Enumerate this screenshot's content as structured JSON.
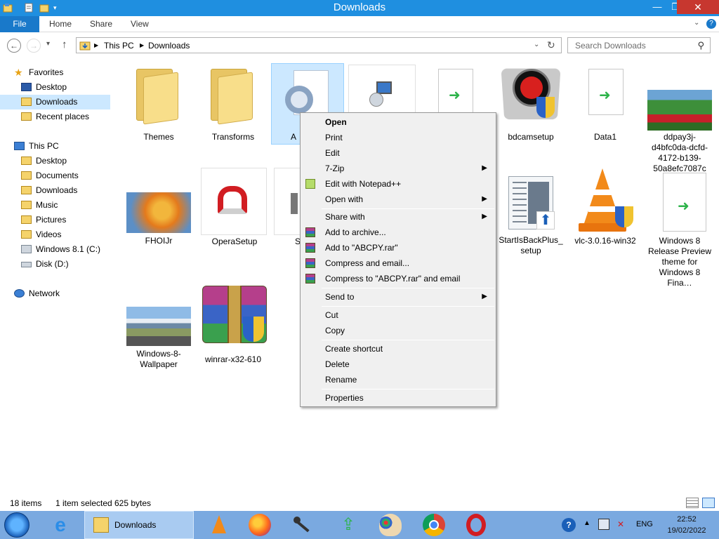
{
  "window": {
    "title": "Downloads",
    "controls": {
      "minimize": "—",
      "maximize": "❐",
      "close": "✕"
    }
  },
  "ribbon": {
    "file": "File",
    "tabs": [
      "Home",
      "Share",
      "View"
    ]
  },
  "nav": {
    "back": "←",
    "forward": "→",
    "recent": "▾",
    "up": "↑",
    "breadcrumb": [
      "This PC",
      "Downloads"
    ],
    "search_placeholder": "Search Downloads"
  },
  "sidebar": {
    "favorites": {
      "label": "Favorites",
      "items": [
        "Desktop",
        "Downloads",
        "Recent places"
      ]
    },
    "this_pc": {
      "label": "This PC",
      "items": [
        "Desktop",
        "Documents",
        "Downloads",
        "Music",
        "Pictures",
        "Videos",
        "Windows 8.1 (C:)",
        "Disk (D:)"
      ]
    },
    "network": {
      "label": "Network"
    }
  },
  "files": [
    {
      "name": "Themes",
      "icon": "folder-icon"
    },
    {
      "name": "Transforms",
      "icon": "folder-icon"
    },
    {
      "name": "A",
      "icon": "settings-file-icon",
      "selected": true
    },
    {
      "name": "",
      "icon": "setup-icon"
    },
    {
      "name": "",
      "icon": "shortcut-file-icon"
    },
    {
      "name": "bdcamsetup",
      "icon": "bandicam-icon"
    },
    {
      "name": "Data1",
      "icon": "shortcut-file-icon"
    },
    {
      "name": "ddpay3j-d4bfc0da-dcfd-4172-b139-50a8efc7087c",
      "icon": "tulips-image-icon"
    },
    {
      "name": "FHOIJr",
      "icon": "autumn-image-icon"
    },
    {
      "name": "OperaSetup",
      "icon": "opera-setup-icon"
    },
    {
      "name": "S",
      "icon": "setup-icon"
    },
    {
      "name": "StartIsBackPlus_setup",
      "icon": "startisback-icon"
    },
    {
      "name": "vlc-3.0.16-win32",
      "icon": "vlc-icon"
    },
    {
      "name": "Windows 8 Release Preview theme for Windows 8 Fina…",
      "icon": "shortcut-file-icon"
    },
    {
      "name": "Windows-8-Wallpaper",
      "icon": "mountain-image-icon"
    },
    {
      "name": "winrar-x32-610",
      "icon": "winrar-icon"
    }
  ],
  "context_menu": [
    {
      "label": "Open",
      "bold": true
    },
    {
      "label": "Print"
    },
    {
      "label": "Edit"
    },
    {
      "label": "7-Zip",
      "submenu": true
    },
    {
      "label": "Edit with Notepad++",
      "icon": "notepadpp-icon"
    },
    {
      "label": "Open with",
      "submenu": true
    },
    {
      "label": "Share with",
      "submenu": true
    },
    {
      "label": "Add to archive...",
      "icon": "winrar-icon"
    },
    {
      "label": "Add to \"ABCPY.rar\"",
      "icon": "winrar-icon"
    },
    {
      "label": "Compress and email...",
      "icon": "winrar-icon"
    },
    {
      "label": "Compress to \"ABCPY.rar\" and email",
      "icon": "winrar-icon"
    },
    {
      "label": "Send to",
      "submenu": true
    },
    {
      "label": "Cut"
    },
    {
      "label": "Copy"
    },
    {
      "label": "Create shortcut"
    },
    {
      "label": "Delete"
    },
    {
      "label": "Rename"
    },
    {
      "label": "Properties"
    }
  ],
  "status": {
    "items": "18 items",
    "selected": "1 item selected",
    "size": "625 bytes"
  },
  "taskbar": {
    "active_window": "Downloads",
    "language": "ENG",
    "time": "22:52",
    "date": "19/02/2022",
    "show_hidden": "▲",
    "help": "?"
  },
  "colors": {
    "titlebar": "#1f8fe0",
    "file_tab": "#1979ca",
    "selection": "#cce8ff",
    "taskbar": "#7aa9e0",
    "close": "#c7372f"
  }
}
